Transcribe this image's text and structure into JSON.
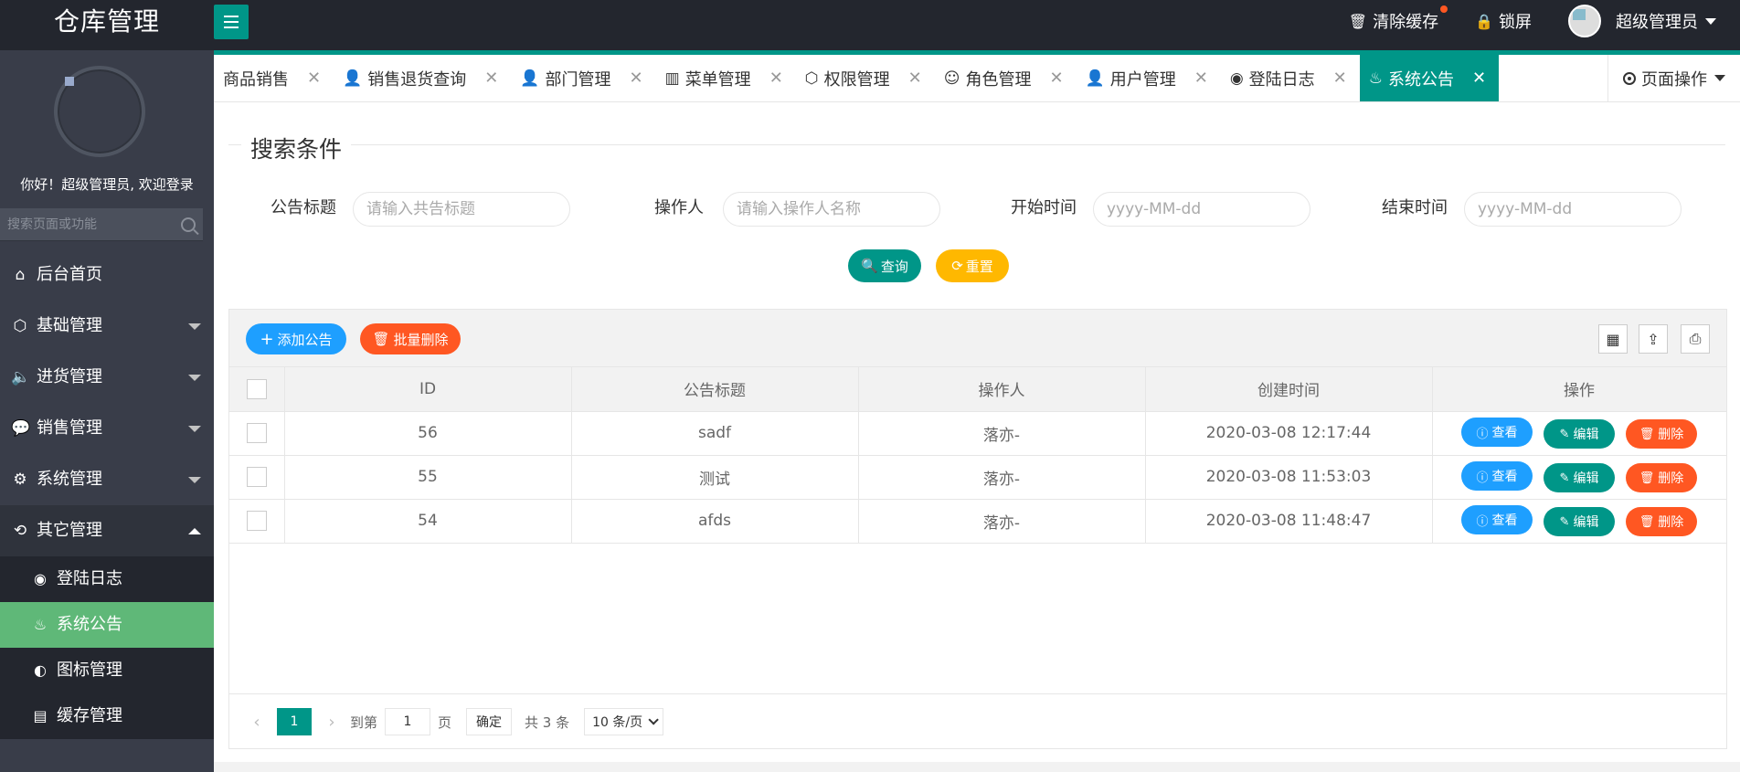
{
  "header": {
    "logo": "仓库管理",
    "clear_cache": "清除缓存",
    "lock_screen": "锁屏",
    "user": "超级管理员"
  },
  "sidebar": {
    "welcome": "你好！超级管理员, 欢迎登录",
    "search_placeholder": "搜索页面或功能",
    "items": [
      {
        "label": "后台首页",
        "icon": "home-icon"
      },
      {
        "label": "基础管理",
        "icon": "cube-icon"
      },
      {
        "label": "进货管理",
        "icon": "volume-icon"
      },
      {
        "label": "销售管理",
        "icon": "chat-icon"
      },
      {
        "label": "系统管理",
        "icon": "gear-icon"
      },
      {
        "label": "其它管理",
        "icon": "loop-icon"
      }
    ],
    "subitems": [
      {
        "label": "登陆日志",
        "icon": "weibo-icon"
      },
      {
        "label": "系统公告",
        "icon": "fire-icon"
      },
      {
        "label": "图标管理",
        "icon": "compass-icon"
      },
      {
        "label": "缓存管理",
        "icon": "cache-icon"
      }
    ]
  },
  "tabs": [
    {
      "label": "商品销售",
      "icon": ""
    },
    {
      "label": "销售退货查询",
      "icon": "user-icon"
    },
    {
      "label": "部门管理",
      "icon": "user-icon"
    },
    {
      "label": "菜单管理",
      "icon": "menu-icon"
    },
    {
      "label": "权限管理",
      "icon": "cube-icon"
    },
    {
      "label": "角色管理",
      "icon": "smile-icon"
    },
    {
      "label": "用户管理",
      "icon": "user-solid-icon"
    },
    {
      "label": "登陆日志",
      "icon": "weibo-icon"
    },
    {
      "label": "系统公告",
      "icon": "fire-icon"
    }
  ],
  "page_ops": "页面操作",
  "search": {
    "legend": "搜索条件",
    "title_label": "公告标题",
    "title_placeholder": "请输入共告标题",
    "operator_label": "操作人",
    "operator_placeholder": "请输入操作人名称",
    "start_label": "开始时间",
    "start_placeholder": "yyyy-MM-dd",
    "end_label": "结束时间",
    "end_placeholder": "yyyy-MM-dd",
    "search_button": "查询",
    "reset_button": "重置"
  },
  "toolbar": {
    "add_button": "添加公告",
    "batch_delete_button": "批量删除"
  },
  "table": {
    "columns": [
      "ID",
      "公告标题",
      "操作人",
      "创建时间",
      "操作"
    ],
    "rows": [
      {
        "id": "56",
        "title": "sadf",
        "operator": "落亦-",
        "created": "2020-03-08 12:17:44"
      },
      {
        "id": "55",
        "title": "测试",
        "operator": "落亦-",
        "created": "2020-03-08 11:53:03"
      },
      {
        "id": "54",
        "title": "afds",
        "operator": "落亦-",
        "created": "2020-03-08 11:48:47"
      }
    ],
    "actions": {
      "view": "查看",
      "edit": "编辑",
      "delete": "删除"
    }
  },
  "pager": {
    "current": "1",
    "goto_label": "到第",
    "goto_value": "1",
    "page_label": "页",
    "confirm": "确定",
    "total": "共 3 条",
    "page_size": "10 条/页"
  },
  "colors": {
    "teal": "#009688",
    "blue": "#1e9fff",
    "orange": "#ff5722",
    "yellow": "#ffb800",
    "green": "#5fb878",
    "dark": "#23262e"
  }
}
